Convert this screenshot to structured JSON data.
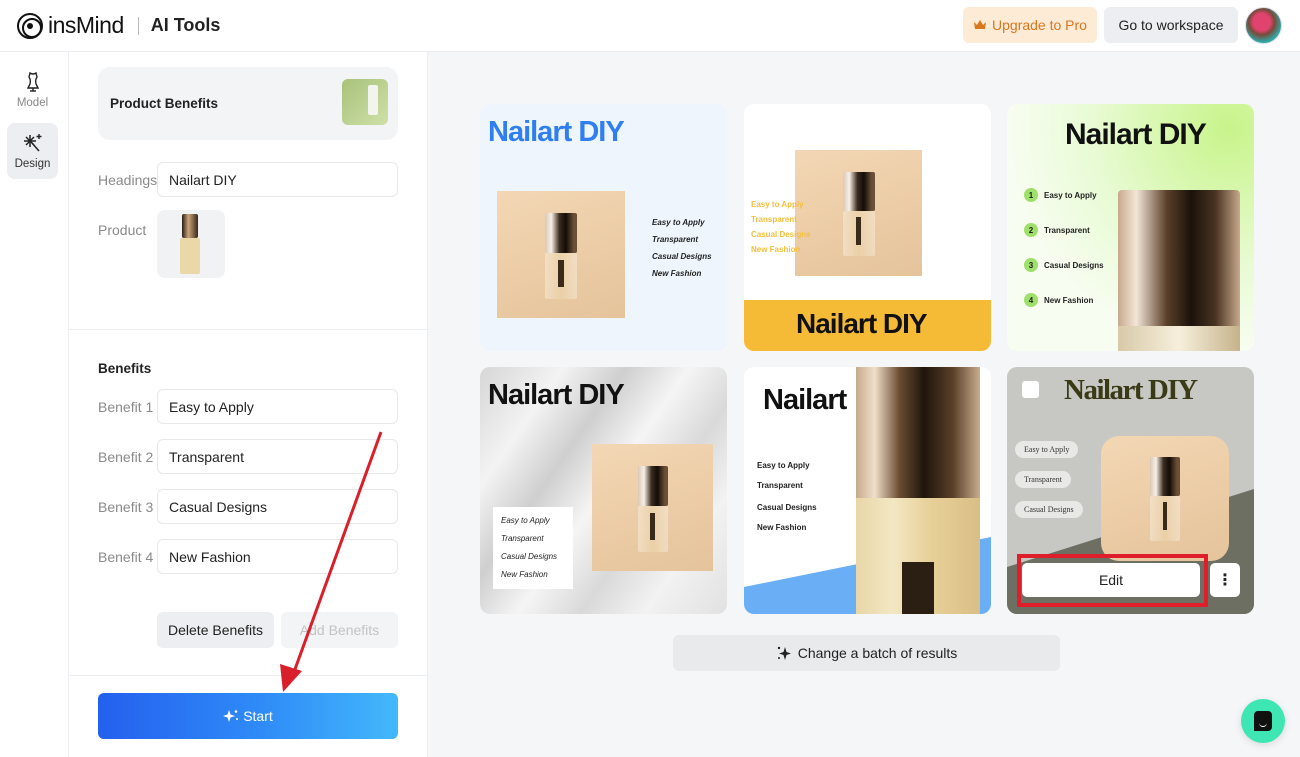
{
  "header": {
    "brand": "insMind",
    "section": "AI Tools",
    "upgrade_label": "Upgrade to Pro",
    "upgrade_icon": "crown-icon",
    "workspace_label": "Go to workspace",
    "avatar": "user-avatar"
  },
  "rail": {
    "items": [
      {
        "label": "Model",
        "icon": "mannequin-icon",
        "active": false
      },
      {
        "label": "Design",
        "icon": "sparkle-wand-icon",
        "active": true
      }
    ]
  },
  "panel": {
    "template_title": "Product Benefits",
    "headings_label": "Headings",
    "headings_value": "Nailart DIY",
    "product_label": "Product",
    "benefits_title": "Benefits",
    "benefits": [
      {
        "label": "Benefit 1",
        "value": "Easy to Apply"
      },
      {
        "label": "Benefit 2",
        "value": "Transparent"
      },
      {
        "label": "Benefit 3",
        "value": "Casual Designs"
      },
      {
        "label": "Benefit 4",
        "value": "New Fashion"
      }
    ],
    "delete_label": "Delete Benefits",
    "add_label": "Add Benefits",
    "start_label": "Start"
  },
  "results": {
    "heading": "Nailart DIY",
    "benefits": [
      "Easy to Apply",
      "Transparent",
      "Casual Designs",
      "New Fashion"
    ],
    "numbers": [
      "1",
      "2",
      "3",
      "4"
    ],
    "card5_heading": "Nailart",
    "edit_label": "Edit",
    "more_label": "⋮",
    "batch_label": "Change a batch of results"
  },
  "colors": {
    "accent_blue": "#2f7ef2",
    "start_gradient_from": "#2460ee",
    "start_gradient_to": "#43b8fb",
    "upgrade_text": "#d9761e",
    "highlight_red": "#e01d2a",
    "chat_green": "#3ee6b4"
  }
}
